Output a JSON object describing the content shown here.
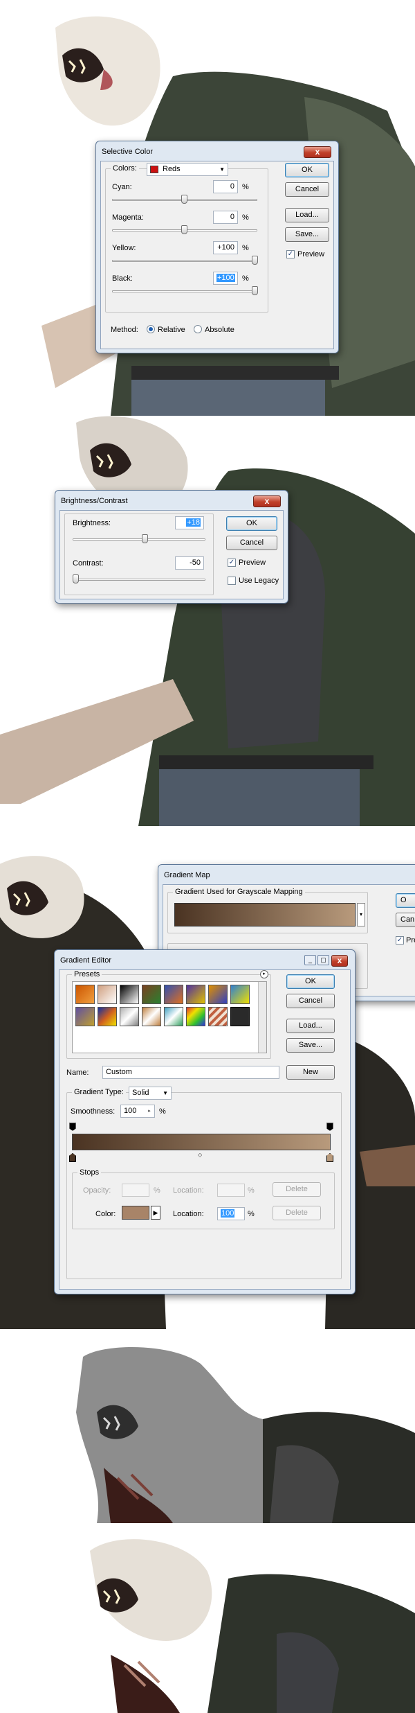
{
  "selective_color": {
    "title": "Selective Color",
    "close": "x",
    "colors_label": "Colors:",
    "colors_value": "Reds",
    "reds_swatch": "#cc1010",
    "sliders": [
      {
        "label": "Cyan:",
        "value": "0",
        "unit": "%"
      },
      {
        "label": "Magenta:",
        "value": "0",
        "unit": "%"
      },
      {
        "label": "Yellow:",
        "value": "+100",
        "unit": "%"
      },
      {
        "label": "Black:",
        "value": "+100",
        "unit": "%"
      }
    ],
    "buttons": {
      "ok": "OK",
      "cancel": "Cancel",
      "load": "Load...",
      "save": "Save..."
    },
    "preview_label": "Preview",
    "method_label": "Method:",
    "method_options": [
      "Relative",
      "Absolute"
    ],
    "method_selected": "Relative"
  },
  "brightness_contrast": {
    "title": "Brightness/Contrast",
    "close": "x",
    "brightness_label": "Brightness:",
    "brightness_value": "+18",
    "contrast_label": "Contrast:",
    "contrast_value": "-50",
    "buttons": {
      "ok": "OK",
      "cancel": "Cancel"
    },
    "preview_label": "Preview",
    "use_legacy_label": "Use Legacy"
  },
  "gradient_map": {
    "title": "Gradient Map",
    "group_label": "Gradient Used for Grayscale Mapping",
    "buttons": {
      "ok": "O",
      "cancel": "Can"
    },
    "preview_label": "Prev",
    "colors": {
      "from": "#4a3322",
      "to": "#b89a7c"
    }
  },
  "gradient_editor": {
    "title": "Gradient Editor",
    "presets_label": "Presets",
    "buttons": {
      "ok": "OK",
      "cancel": "Cancel",
      "load": "Load...",
      "save": "Save...",
      "new": "New"
    },
    "name_label": "Name:",
    "name_value": "Custom",
    "gradient_type_label": "Gradient Type:",
    "gradient_type_value": "Solid",
    "smoothness_label": "Smoothness:",
    "smoothness_value": "100",
    "smoothness_unit": "%",
    "stops_label": "Stops",
    "opacity_label": "Opacity:",
    "opacity_unit": "%",
    "location_label": "Location:",
    "location_unit": "%",
    "delete_label": "Delete",
    "color_label": "Color:",
    "color_location_value": "100",
    "stop_color": "#a88468",
    "gradient_colors": {
      "from": "#4a3322",
      "to": "#b89a7c"
    },
    "preset_colors": [
      [
        "#cc5500",
        "#d0a080",
        "#444444",
        "#7a4020",
        "#3050b0",
        "#a050a0",
        "#e09000",
        "#3080d0"
      ],
      [
        "#6050a0",
        "#d06020",
        "#b0b0b0",
        "#6090c0",
        "#40a0c0",
        "#c06040",
        "#c08060",
        "#2a2a2a"
      ]
    ]
  }
}
